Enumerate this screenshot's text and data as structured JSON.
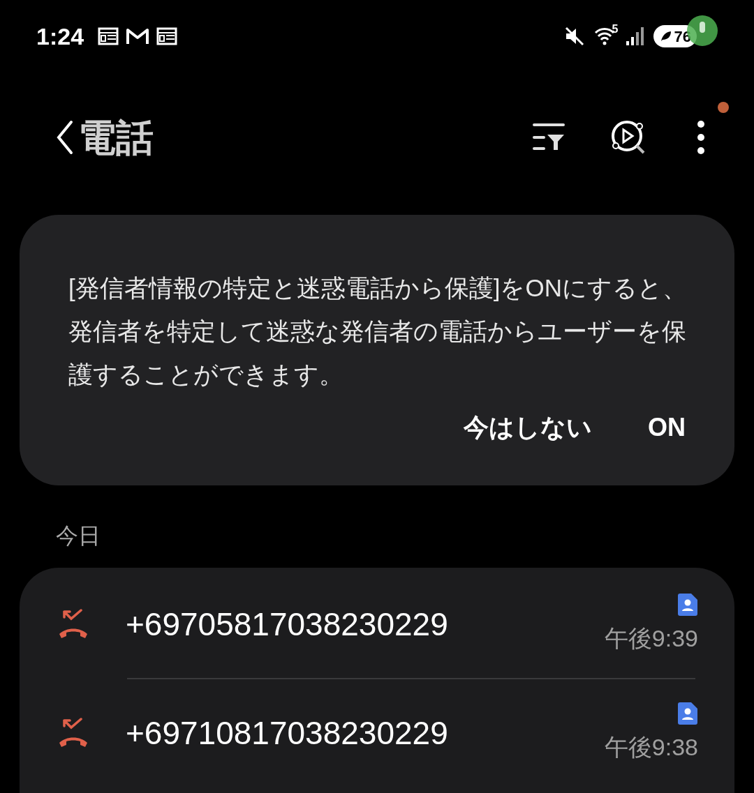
{
  "status_bar": {
    "time": "1:24",
    "wifi_band": "5",
    "battery": "76"
  },
  "header": {
    "title": "電話",
    "notification_dot": true
  },
  "banner": {
    "message": "[発信者情報の特定と迷惑電話から保護]をONにすると、発信者を特定して迷惑な発信者の電話からユーザーを保護することができます。",
    "buttons": [
      "今はしない",
      "ON"
    ]
  },
  "section": "今日",
  "calls": [
    {
      "kind": "missed",
      "number": "+69705817038230229",
      "time": "午後9:39",
      "has_contact_card": true
    },
    {
      "kind": "missed",
      "number": "+69710817038230229",
      "time": "午後9:38",
      "has_contact_card": true
    }
  ]
}
